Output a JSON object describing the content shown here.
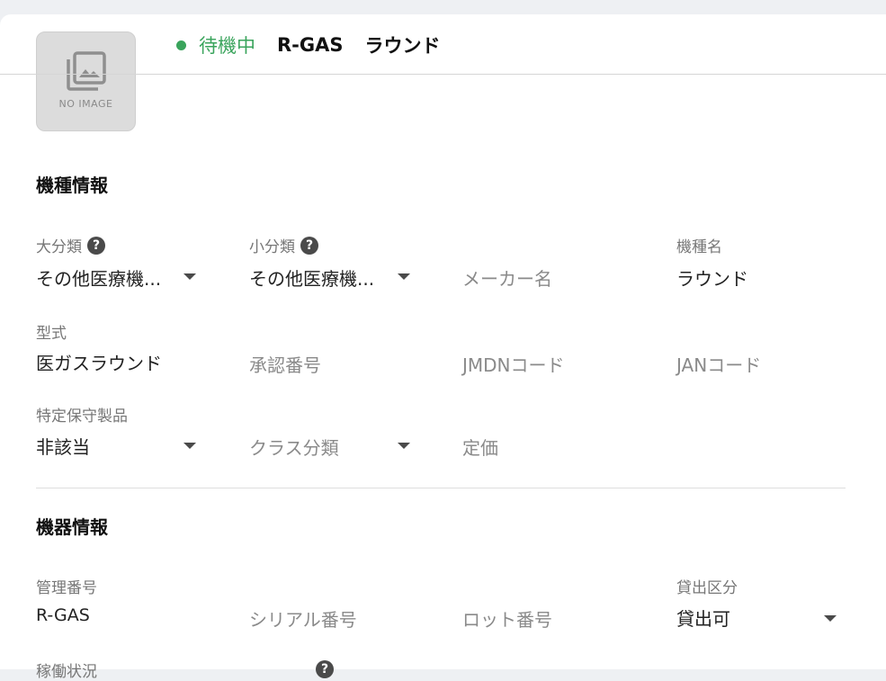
{
  "header": {
    "status": "待機中",
    "status_color": "#3aa45c",
    "management_code": "R-GAS",
    "model_name": "ラウンド",
    "thumbnail_text": "NO IMAGE"
  },
  "model_info": {
    "title": "機種情報",
    "major_category": {
      "label": "大分類",
      "value": "その他医療機..."
    },
    "minor_category": {
      "label": "小分類",
      "value": "その他医療機..."
    },
    "maker": {
      "placeholder": "メーカー名"
    },
    "model_name": {
      "label": "機種名",
      "value": "ラウンド"
    },
    "model_type": {
      "label": "型式",
      "value": "医ガスラウンド"
    },
    "approval_number": {
      "placeholder": "承認番号"
    },
    "jmdn_code": {
      "placeholder": "JMDNコード"
    },
    "jan_code": {
      "placeholder": "JANコード"
    },
    "specified_maintenance": {
      "label": "特定保守製品",
      "value": "非該当"
    },
    "class": {
      "placeholder": "クラス分類"
    },
    "list_price": {
      "placeholder": "定価"
    }
  },
  "device_info": {
    "title": "機器情報",
    "management_number": {
      "label": "管理番号",
      "value": "R-GAS"
    },
    "serial_number": {
      "placeholder": "シリアル番号"
    },
    "lot_number": {
      "placeholder": "ロット番号"
    },
    "lending": {
      "label": "貸出区分",
      "value": "貸出可"
    },
    "operating_status": {
      "label": "稼働状況"
    }
  },
  "help_glyph": "?"
}
